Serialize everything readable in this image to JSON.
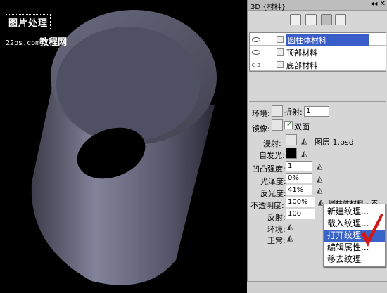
{
  "watermark": {
    "line1": "图片处理",
    "line2_prefix": "22ps.com",
    "line2_suffix": "教程网"
  },
  "panel": {
    "title": "3D {材料}",
    "materials": [
      "圆柱体材料",
      "顶部材料",
      "底部材料"
    ],
    "env_label": "环境:",
    "refract_label": "折射:",
    "refract_value": "1",
    "mirror_label": "镜像:",
    "double_label": "双面",
    "diffuse_label": "漫射:",
    "diffuse_file": "图层 1.psd",
    "selfillum_label": "自发光:",
    "bump_label": "凹凸强度:",
    "bump_value": "1",
    "gloss_label": "光泽度:",
    "gloss_value": "0%",
    "shine_label": "反光度:",
    "shine_value": "41%",
    "opacity_label": "不透明度:",
    "opacity_value": "100%",
    "opacity_link": "圆柱体材料 - 不",
    "reflect_label": "反射:",
    "reflect_value": "100",
    "environment_label": "环境:",
    "normal_label": "正常:"
  },
  "menu": [
    "新建纹理...",
    "载入纹理...",
    "打开纹理",
    "编辑属性...",
    "移去纹理"
  ],
  "colors": {
    "highlight": "#3a64c8",
    "check": "#d01818"
  }
}
